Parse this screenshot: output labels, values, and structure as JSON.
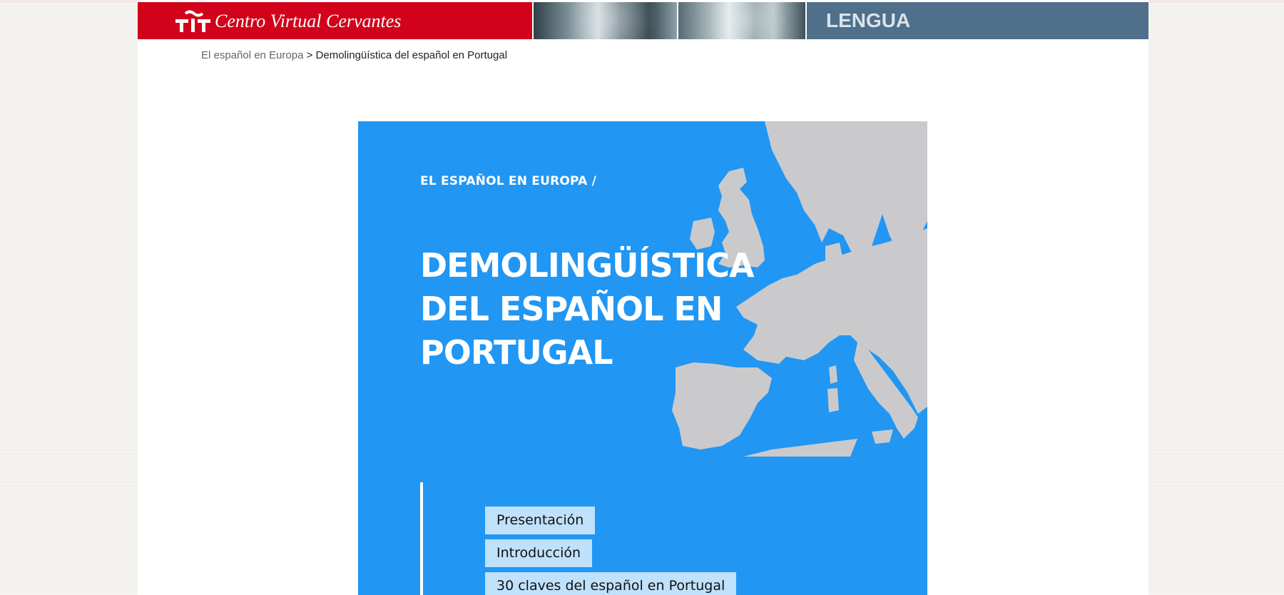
{
  "header": {
    "logo_text": "Centro Virtual Cervantes",
    "section_label": "LENGUA",
    "logo_icon": "cervantes-logo-icon",
    "colors": {
      "logo_bg": "#d1021a",
      "section_bg": "#4f6f8b"
    }
  },
  "breadcrumb": {
    "parent_link": "El español en Europa",
    "separator": ">",
    "current": "Demolingüística del español en Portugal"
  },
  "cover": {
    "kicker": "EL ESPAÑOL EN EUROPA /",
    "title_lines": [
      "DEMOLINGÜÍSTICA",
      "DEL ESPAÑOL EN",
      "PORTUGAL"
    ],
    "background_color": "#2196f3",
    "map_icon": "europe-map-icon",
    "menu": [
      {
        "label": "Presentación"
      },
      {
        "label": "Introducción"
      },
      {
        "label": "30 claves del español en Portugal"
      }
    ]
  }
}
